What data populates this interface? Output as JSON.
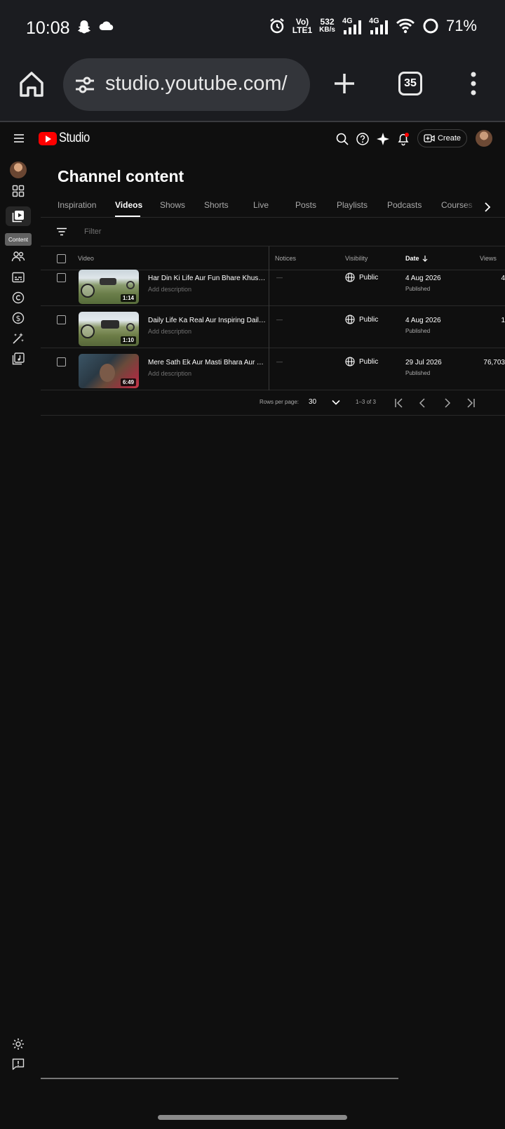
{
  "status_bar": {
    "time": "10:08",
    "net_speed_value": "532",
    "net_speed_unit": "KB/s",
    "carrier_top": "Vo)",
    "carrier_bottom": "LTE1",
    "sig1_label": "4G",
    "sig2_label": "4G",
    "battery": "71%"
  },
  "browser": {
    "url": "studio.youtube.com/",
    "tab_count": "35"
  },
  "header": {
    "logo_text": "Studio",
    "create_label": "Create"
  },
  "rail": {
    "tooltip": "Content"
  },
  "page": {
    "title": "Channel content"
  },
  "tabs": [
    "Inspiration",
    "Videos",
    "Shows",
    "Shorts",
    "Live",
    "Posts",
    "Playlists",
    "Podcasts",
    "Courses"
  ],
  "filter": {
    "placeholder": "Filter"
  },
  "table": {
    "headers": {
      "video": "Video",
      "notices": "Notices",
      "visibility": "Visibility",
      "date": "Date",
      "views": "Views"
    },
    "rows": [
      {
        "title": "Har Din Ki Life Aur Fun Bhare Khushi ke Pal",
        "desc": "Add description",
        "duration": "1:14",
        "notice": "—",
        "visibility": "Public",
        "date": "4 Aug 2026",
        "status": "Published",
        "views": "4"
      },
      {
        "title": "Daily Life Ka Real Aur Inspiring Daily Vlog",
        "desc": "Add description",
        "duration": "1:10",
        "notice": "—",
        "visibility": "Public",
        "date": "4 Aug 2026",
        "status": "Published",
        "views": "1"
      },
      {
        "title": "Mere Sath Ek Aur Masti Bhara Aur Yaadgar Din",
        "desc": "Add description",
        "duration": "6:49",
        "notice": "—",
        "visibility": "Public",
        "date": "29 Jul 2026",
        "status": "Published",
        "views": "76,703"
      }
    ]
  },
  "pager": {
    "rows_per_page_label": "Rows per page:",
    "rows_per_page": "30",
    "range": "1–3 of 3"
  },
  "colors": {
    "background": "#0f0f0f",
    "brand_red": "#ff0000",
    "chrome_bar": "#1b1c20"
  }
}
